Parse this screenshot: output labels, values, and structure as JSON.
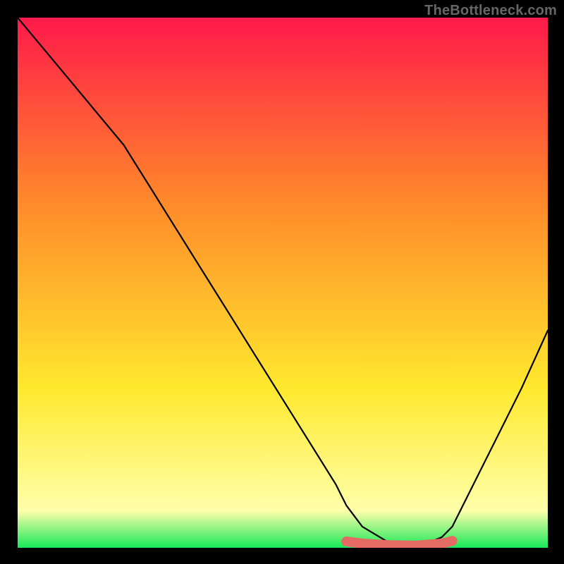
{
  "watermark": "TheBottleneck.com",
  "colors": {
    "gradient_top": "#ff1a4a",
    "gradient_mid1": "#ff8a2a",
    "gradient_mid2": "#ffe92e",
    "gradient_pale": "#ffffaa",
    "gradient_bottom": "#18e858",
    "curve": "#000000",
    "marker": "#e46a63",
    "background": "#000000"
  },
  "chart_data": {
    "type": "line",
    "title": "",
    "xlabel": "",
    "ylabel": "",
    "xlim": [
      0,
      100
    ],
    "ylim": [
      0,
      100
    ],
    "grid": false,
    "series": [
      {
        "name": "bottleneck-curve",
        "x": [
          0,
          5,
          10,
          15,
          20,
          25,
          30,
          35,
          40,
          45,
          50,
          55,
          60,
          62,
          65,
          70,
          75,
          80,
          82,
          85,
          90,
          95,
          100
        ],
        "y": [
          100,
          94,
          88,
          82,
          76,
          68,
          60,
          52,
          44,
          36,
          28,
          20,
          12,
          8,
          4,
          1,
          0,
          2,
          4,
          10,
          20,
          30,
          41
        ]
      }
    ],
    "highlight": {
      "name": "minimum-region",
      "x": [
        62,
        65,
        70,
        75,
        80,
        82
      ],
      "y": [
        1.2,
        0.8,
        0.5,
        0.4,
        0.8,
        1.3
      ]
    }
  }
}
